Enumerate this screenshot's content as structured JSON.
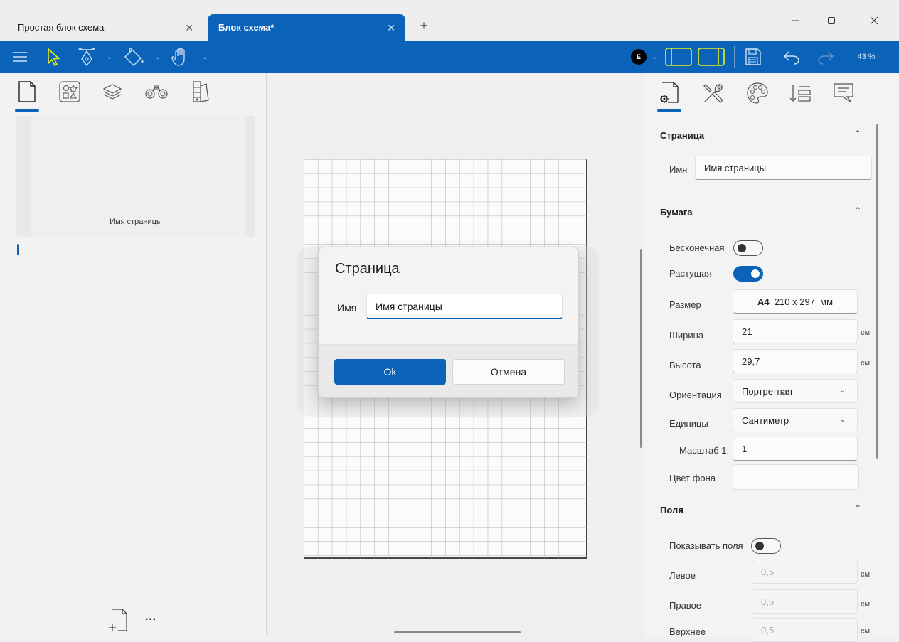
{
  "tabs": [
    {
      "label": "Простая блок схема",
      "active": false
    },
    {
      "label": "Блок схема*",
      "active": true
    }
  ],
  "window_controls": [
    "minimize-icon",
    "maximize-icon",
    "close-icon"
  ],
  "toolbar": {
    "tools": [
      "menu-icon",
      "pointer-icon",
      "pen-icon",
      "paint-bucket-icon",
      "hand-icon"
    ],
    "user_initial": "E",
    "zoom": "43 %",
    "accent": "#0a63b8",
    "pointer_color": "#e8f01c"
  },
  "left_panel": {
    "tabs": [
      "page-icon",
      "shapes-icon",
      "layers-icon",
      "binoculars-icon",
      "palette-swatch-icon"
    ],
    "thumbnail_label": "Имя страницы",
    "more": "···"
  },
  "dialog": {
    "title": "Страница",
    "name_label": "Имя",
    "name_value": "Имя страницы",
    "ok_label": "Ok",
    "cancel_label": "Отмена"
  },
  "right_panel": {
    "tabs": [
      "page-settings-icon",
      "tools-icon",
      "color-palette-icon",
      "sort-icon",
      "comment-icon"
    ],
    "page_section": {
      "title": "Страница",
      "name_label": "Имя",
      "name_value": "Имя страницы"
    },
    "paper_section": {
      "title": "Бумага",
      "infinite_label": "Бесконечная",
      "infinite_on": false,
      "growing_label": "Растущая",
      "growing_on": true,
      "size_label": "Размер",
      "size_name": "A4",
      "size_dims": "210 x 297",
      "size_unit": "мм",
      "width_label": "Ширина",
      "width_value": "21",
      "width_unit": "см",
      "height_label": "Высота",
      "height_value": "29,7",
      "height_unit": "см",
      "orientation_label": "Ориентация",
      "orientation_value": "Портретная",
      "units_label": "Единицы",
      "units_value": "Сантиметр",
      "scale_label": "Масштаб 1:",
      "scale_value": "1",
      "bg_label": "Цвет фона"
    },
    "margins_section": {
      "title": "Поля",
      "show_label": "Показывать поля",
      "show_on": false,
      "left_label": "Левое",
      "left_value": "0,5",
      "left_unit": "см",
      "right_label": "Правое",
      "right_value": "0,5",
      "right_unit": "см",
      "top_label": "Верхнее",
      "top_value": "0,5",
      "top_unit": "см"
    }
  }
}
